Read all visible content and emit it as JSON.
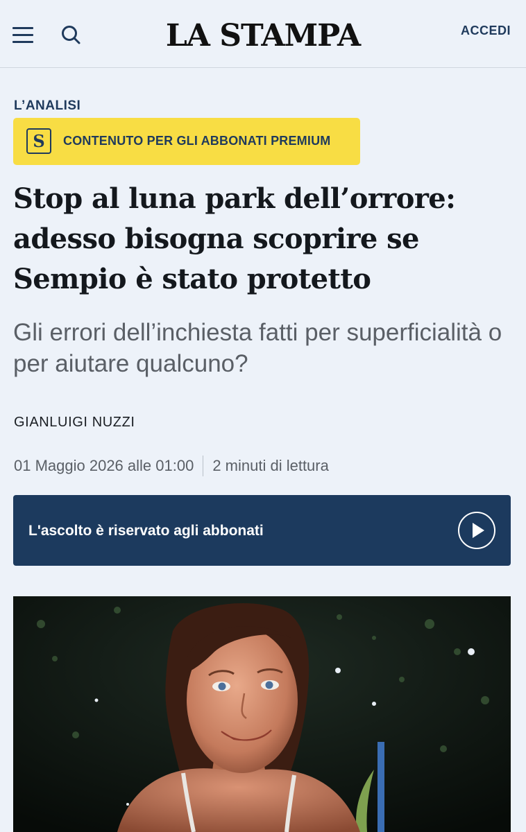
{
  "header": {
    "logo": "LA STAMPA",
    "login_label": "ACCEDI",
    "menu_icon": "hamburger-menu-icon",
    "search_icon": "search-icon"
  },
  "article": {
    "kicker": "L’ANALISI",
    "premium_badge_letter": "S",
    "premium_label": "CONTENUTO PER GLI ABBONATI PREMIUM",
    "headline": "Stop al luna park dell’orrore: adesso bisogna scoprire se Sempio è stato protetto",
    "subtitle": "Gli errori dell’inchiesta fatti per superficialità o per aiutare qualcuno?",
    "author": "GIANLUIGI NUZZI",
    "date": "01 Maggio 2026 alle 01:00",
    "reading_time": "2 minuti di lettura"
  },
  "audio_player": {
    "label": "L'ascolto è riservato agli abbonati",
    "play_icon": "play-icon"
  },
  "colors": {
    "background": "#edf2f9",
    "brand_navy": "#1c3a5e",
    "premium_yellow": "#f8dd44"
  }
}
